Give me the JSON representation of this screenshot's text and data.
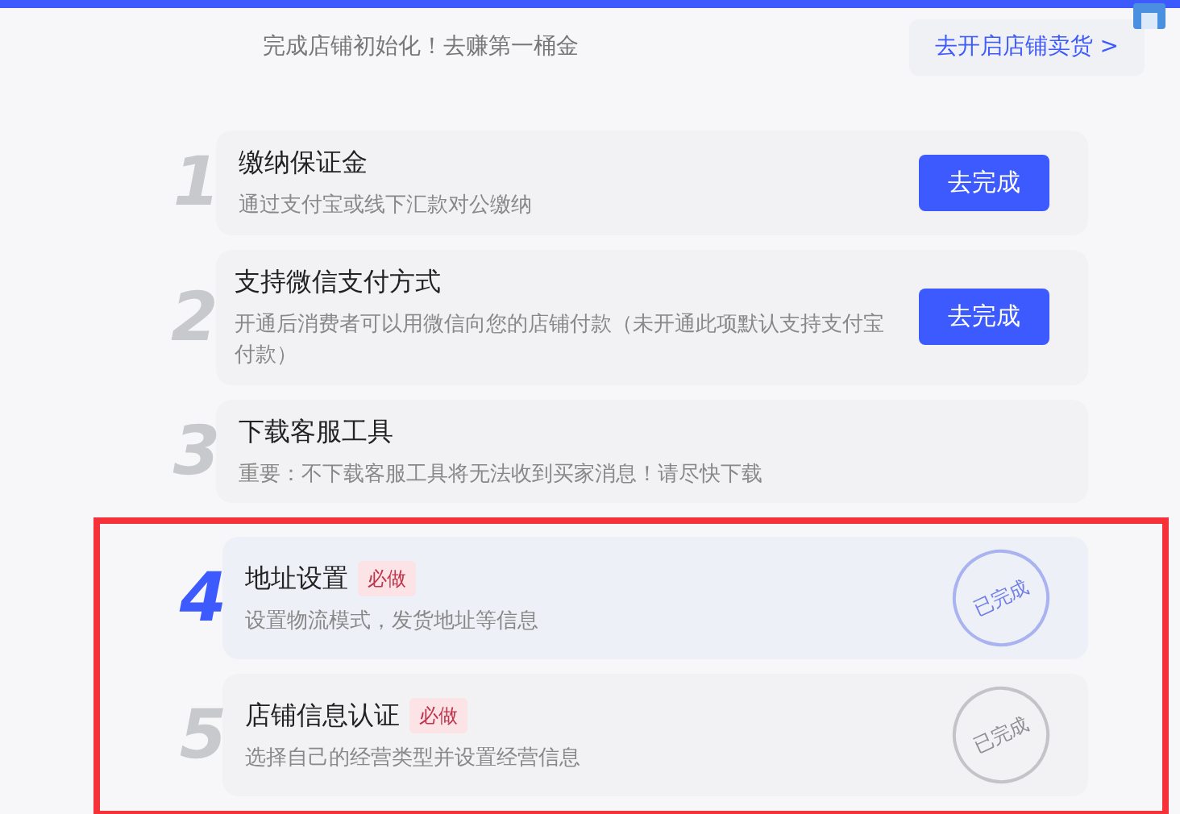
{
  "header": {
    "message": "完成店铺初始化！去赚第一桶金",
    "open_store_button": "去开启店铺卖货 >"
  },
  "steps": [
    {
      "number": "1",
      "title": "缴纳保证金",
      "description": "通过支付宝或线下汇款对公缴纳",
      "action": "去完成",
      "current": false,
      "highlighted": false
    },
    {
      "number": "2",
      "title": "支持微信支付方式",
      "description": "开通后消费者可以用微信向您的店铺付款（未开通此项默认支持支付宝付款）",
      "action": "去完成",
      "current": false,
      "highlighted": false
    },
    {
      "number": "3",
      "title": "下载客服工具",
      "description": "重要：不下载客服工具将无法收到买家消息！请尽快下载",
      "current": false,
      "highlighted": false
    },
    {
      "number": "4",
      "title": "地址设置",
      "badge": "必做",
      "description": "设置物流模式，发货地址等信息",
      "stamp": "已完成",
      "current": true,
      "highlighted": true
    },
    {
      "number": "5",
      "title": "店铺信息认证",
      "badge": "必做",
      "description": "选择自己的经营类型并设置经营信息",
      "stamp": "已完成",
      "current": false,
      "highlighted": true
    }
  ]
}
